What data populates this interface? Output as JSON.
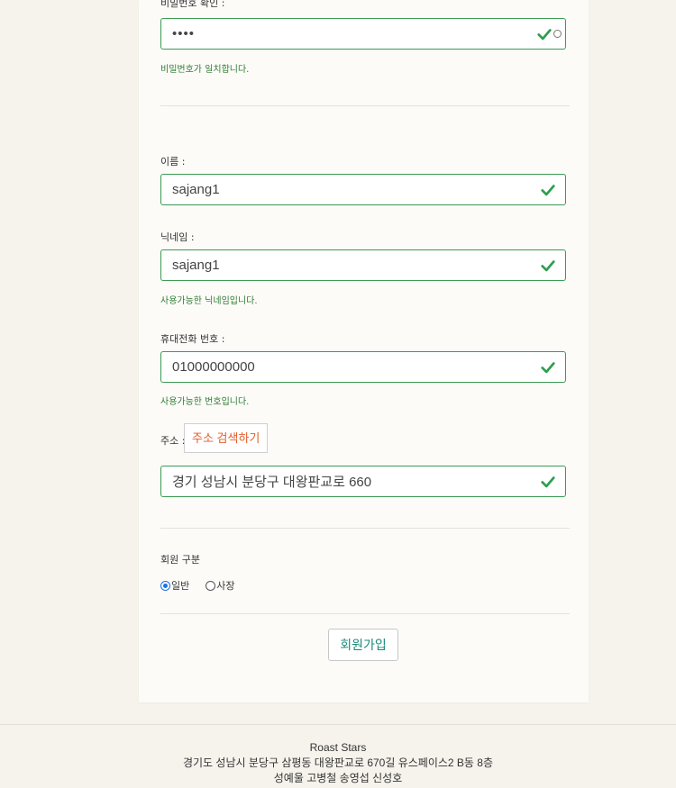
{
  "password_confirm": {
    "label": "비밀번호 확인 :",
    "value": "••••",
    "message": "비밀번호가 일치합니다."
  },
  "name": {
    "label": "이름 :",
    "value": "sajang1"
  },
  "nickname": {
    "label": "닉네임 :",
    "value": "sajang1",
    "message": "사용가능한 닉네임입니다."
  },
  "phone": {
    "label": "휴대전화 번호 :",
    "value": "01000000000",
    "message": "사용가능한 번호입니다."
  },
  "address": {
    "label": "주소 :",
    "search_button": "주소 검색하기",
    "value": "경기 성남시 분당구 대왕판교로 660"
  },
  "member_type": {
    "label": "회원 구분",
    "options": [
      "일반",
      "사장"
    ],
    "selected": "일반"
  },
  "submit_label": "회원가입",
  "footer": {
    "company": "Roast Stars",
    "address": "경기도 성남시 분당구 삼평동 대왕판교로 670길 유스페이스2 B동 8층",
    "members": "성예울 고병철 송영섭 신성호"
  },
  "colors": {
    "valid_border": "#3a9a52",
    "valid_check": "#2e9e4f",
    "message": "#2e7d32",
    "address_button_text": "#e35d2b",
    "submit_text": "#1a8a7a",
    "radio_selected": "#1a73e8"
  },
  "icons": {
    "valid": "checkmark-icon",
    "password_reveal": "eye-icon"
  }
}
